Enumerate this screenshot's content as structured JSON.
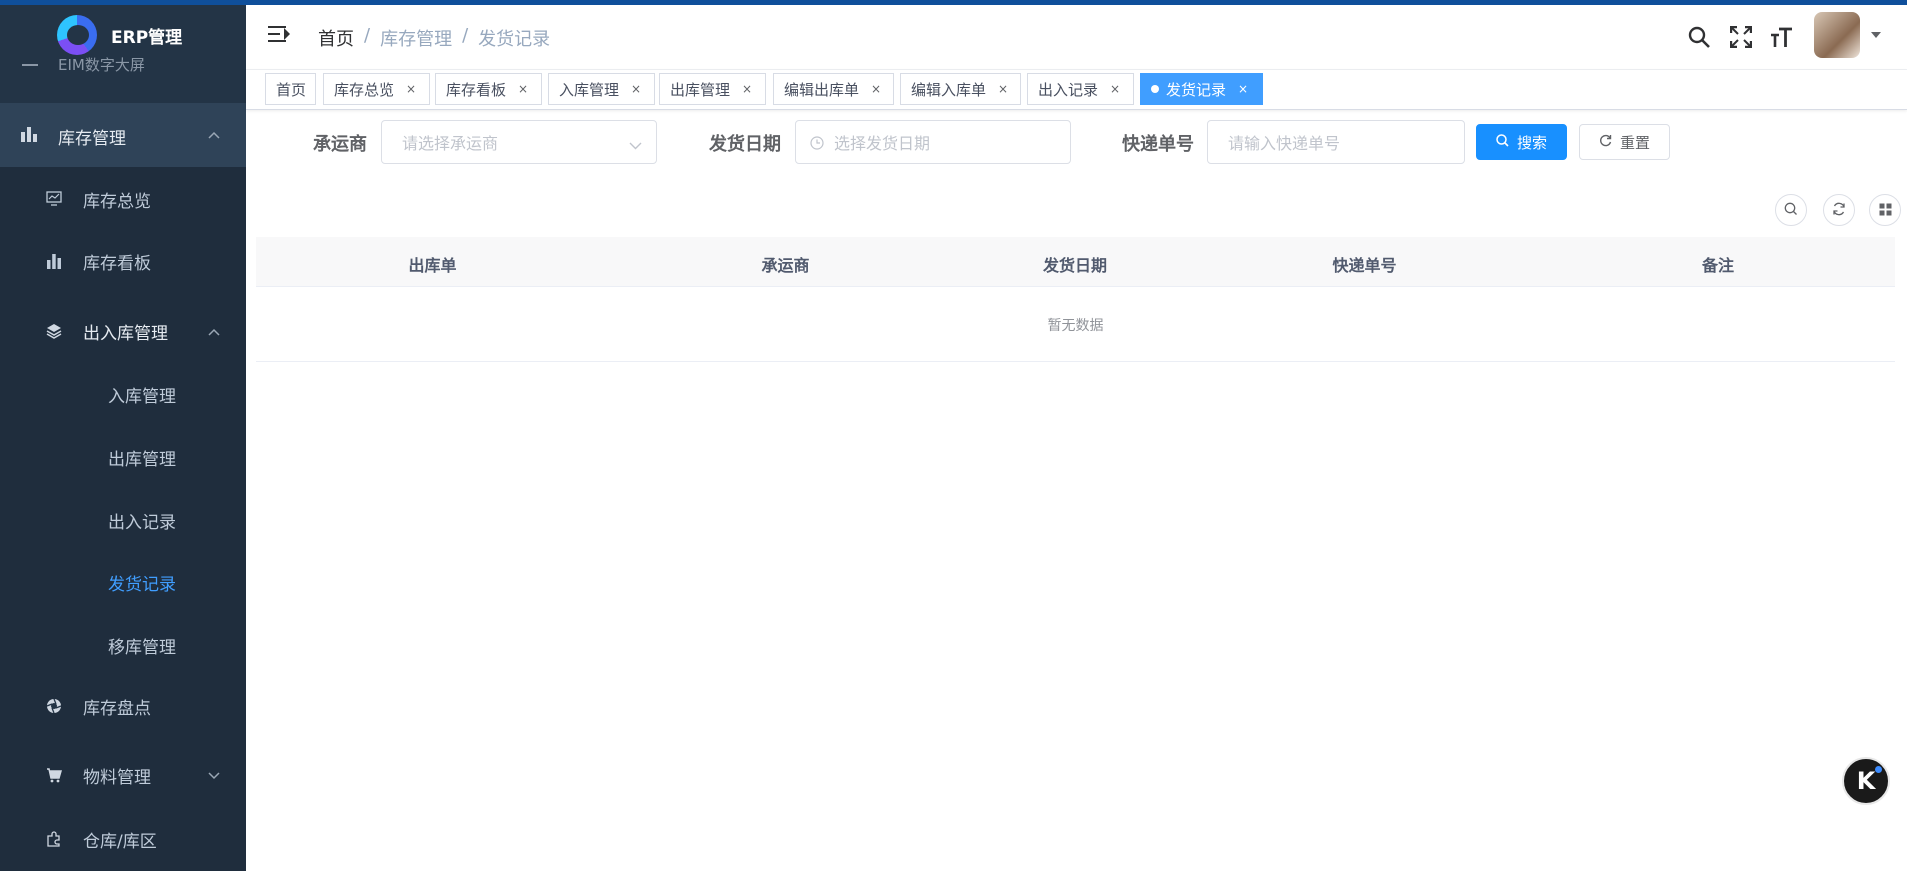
{
  "app": {
    "title": "ERP管理"
  },
  "sidebar": {
    "clipped_item": "EIM数字大屏",
    "groups": [
      {
        "label": "库存管理",
        "icon": "bar-chart-icon",
        "expanded": true
      },
      {
        "label": "出入库管理",
        "icon": "layers-icon",
        "expanded": true
      },
      {
        "label": "库存盘点",
        "icon": "aperture-icon"
      },
      {
        "label": "物料管理",
        "icon": "cart-icon",
        "expanded": false
      },
      {
        "label": "仓库/库区",
        "icon": "puzzle-icon"
      }
    ],
    "items": [
      {
        "label": "库存总览",
        "icon": "monitor-chart-icon"
      },
      {
        "label": "库存看板",
        "icon": "bar-chart-icon"
      }
    ],
    "subitems": [
      {
        "label": "入库管理"
      },
      {
        "label": "出库管理"
      },
      {
        "label": "出入记录"
      },
      {
        "label": "发货记录",
        "selected": true
      },
      {
        "label": "移库管理"
      }
    ]
  },
  "breadcrumb": [
    "首页",
    "库存管理",
    "发货记录"
  ],
  "tags": [
    {
      "label": "首页"
    },
    {
      "label": "库存总览"
    },
    {
      "label": "库存看板"
    },
    {
      "label": "入库管理"
    },
    {
      "label": "出库管理"
    },
    {
      "label": "编辑出库单"
    },
    {
      "label": "编辑入库单"
    },
    {
      "label": "出入记录"
    },
    {
      "label": "发货记录",
      "active": true
    }
  ],
  "search": {
    "carrier_label": "承运商",
    "carrier_placeholder": "请选择承运商",
    "date_label": "发货日期",
    "date_placeholder": "选择发货日期",
    "tracking_label": "快递单号",
    "tracking_placeholder": "请输入快递单号",
    "search_button": "搜索",
    "reset_button": "重置"
  },
  "table": {
    "columns": [
      "出库单",
      "承运商",
      "发货日期",
      "快递单号",
      "备注"
    ],
    "rows": [],
    "empty_text": "暂无数据"
  },
  "colors": {
    "sidebar_bg": "#233446",
    "accent": "#1890ff",
    "tag_active": "#409eff"
  }
}
